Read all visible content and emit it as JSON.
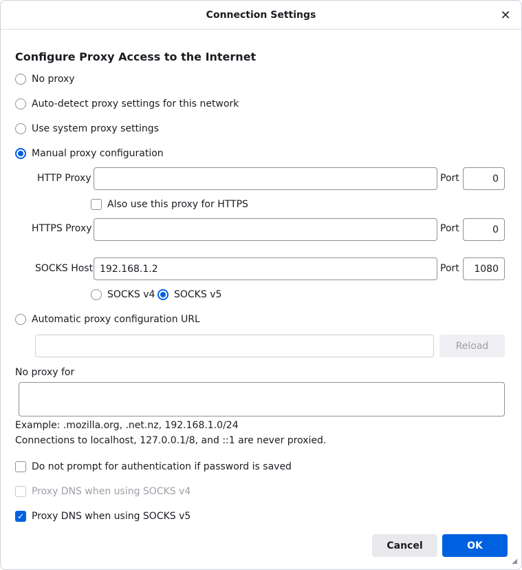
{
  "window": {
    "title": "Connection Settings",
    "close_symbol": "✕"
  },
  "heading": "Configure Proxy Access to the Internet",
  "proxy_modes": {
    "no_proxy": "No proxy",
    "auto_detect": "Auto-detect proxy settings for this network",
    "system": "Use system proxy settings",
    "manual": "Manual proxy configuration",
    "auto_url": "Automatic proxy configuration URL",
    "selected": "manual"
  },
  "manual": {
    "http_label": "HTTP Proxy",
    "http_value": "",
    "port_label": "Port",
    "http_port": "0",
    "also_https_label": "Also use this proxy for HTTPS",
    "https_label": "HTTPS Proxy",
    "https_value": "",
    "https_port": "0",
    "socks_label": "SOCKS Host",
    "socks_value": "192.168.1.2",
    "socks_port": "1080",
    "socks_v4": "SOCKS v4",
    "socks_v5": "SOCKS v5"
  },
  "auto_url": {
    "value": "",
    "reload_label": "Reload"
  },
  "no_proxy_for": {
    "label": "No proxy for",
    "value": "",
    "example": "Example: .mozilla.org, .net.nz, 192.168.1.0/24",
    "note": "Connections to localhost, 127.0.0.1/8, and ::1 are never proxied."
  },
  "options": {
    "no_prompt_auth": "Do not prompt for authentication if password is saved",
    "dns_socks_v4": "Proxy DNS when using SOCKS v4",
    "dns_socks_v5": "Proxy DNS when using SOCKS v5",
    "check_symbol": "✓"
  },
  "buttons": {
    "cancel": "Cancel",
    "ok": "OK"
  },
  "colors": {
    "accent": "#0061e0",
    "border": "#8f8f9d"
  }
}
